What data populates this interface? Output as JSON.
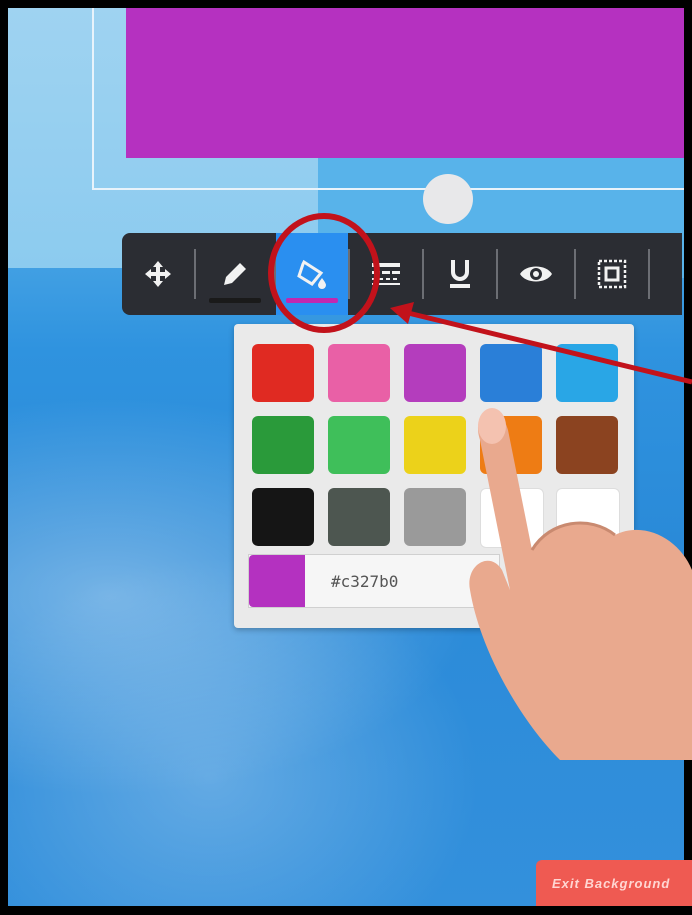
{
  "canvas": {
    "shape_color": "#b531c0",
    "background_top_color": "#8ccbef",
    "background_bottom_color": "#2a8ad8"
  },
  "toolbar": {
    "tools": [
      {
        "name": "move",
        "icon": "move-arrows-icon",
        "active": false
      },
      {
        "name": "pen",
        "icon": "pencil-icon",
        "active": false
      },
      {
        "name": "fill",
        "icon": "paint-bucket-icon",
        "active": true,
        "fill_color": "#c327b0"
      },
      {
        "name": "line-style",
        "icon": "line-style-icon",
        "active": false
      },
      {
        "name": "underline",
        "icon": "underline-icon",
        "active": false
      },
      {
        "name": "visibility",
        "icon": "eye-icon",
        "active": false
      },
      {
        "name": "border",
        "icon": "border-icon",
        "active": false
      }
    ]
  },
  "color_picker": {
    "swatches": [
      "#e02a22",
      "#e960a6",
      "#b43dbd",
      "#2a7fd8",
      "#29a6e6",
      "#2a9a3a",
      "#3fbf5a",
      "#ecd21a",
      "#ee7c14",
      "#8b4320",
      "#151515",
      "#4d5650",
      "#9a9a9a",
      "#ffffff",
      "#ffffff"
    ],
    "hex_value": "#c327b0",
    "preview_color": "#b431c0"
  },
  "footer": {
    "exit_label": "Exit Background"
  }
}
